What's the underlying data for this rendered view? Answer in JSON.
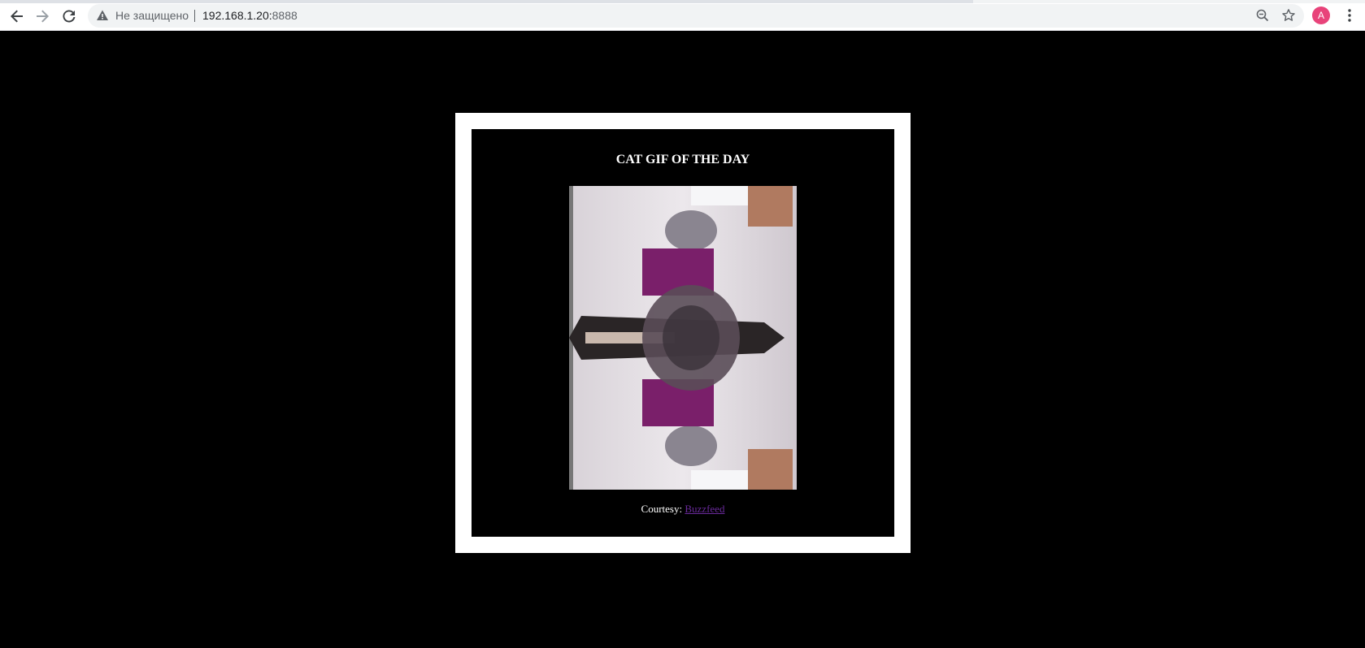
{
  "browser": {
    "security_label": "Не защищено",
    "url_host": "192.168.1.20:",
    "url_port": "8888",
    "avatar_letter": "A"
  },
  "page": {
    "title": "CAT GIF OF THE DAY",
    "courtesy_label": "Courtesy:",
    "courtesy_link": "Buzzfeed"
  },
  "colors": {
    "page_background": "#000000",
    "frame": "#ffffff",
    "link": "#6a2a9c",
    "avatar": "#e8437a",
    "box_magenta": "#7a1f6a"
  },
  "icons": {
    "back": "arrow-left-icon",
    "forward": "arrow-right-icon",
    "reload": "reload-icon",
    "warning": "warning-triangle-icon",
    "zoom": "zoom-out-icon",
    "bookmark": "star-icon",
    "menu": "three-dots-vertical-icon"
  }
}
